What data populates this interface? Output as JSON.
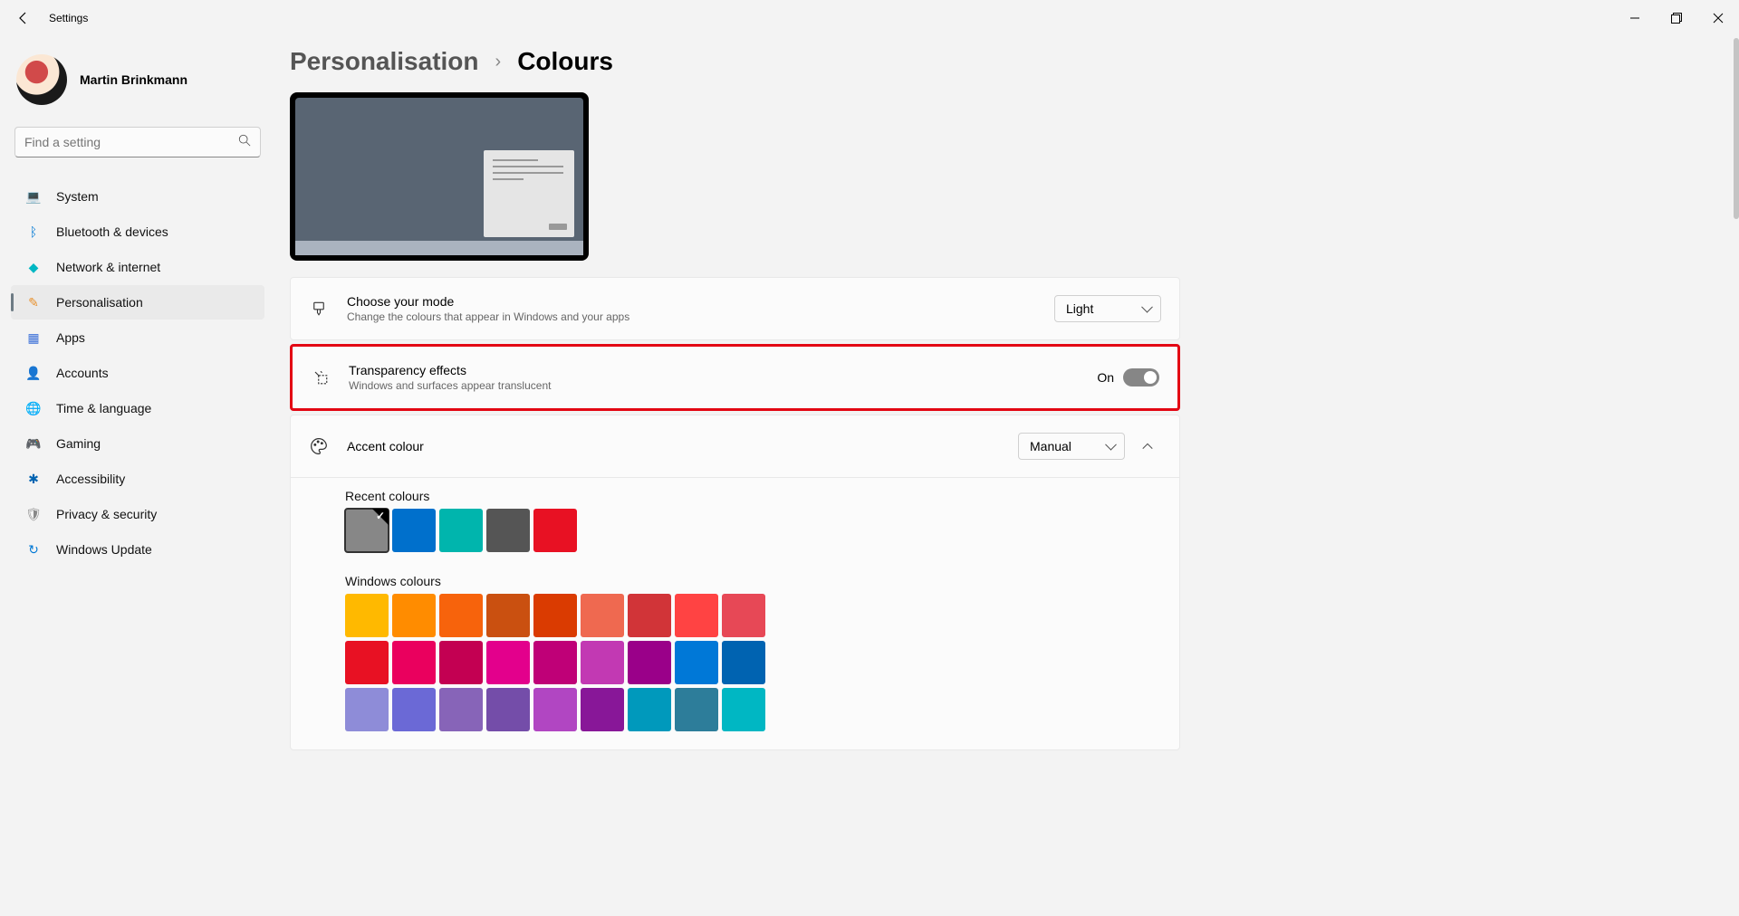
{
  "app": {
    "title": "Settings"
  },
  "user": {
    "name": "Martin Brinkmann"
  },
  "search": {
    "placeholder": "Find a setting"
  },
  "nav": {
    "items": [
      {
        "label": "System",
        "icon": "💻",
        "color": "#0078d4"
      },
      {
        "label": "Bluetooth & devices",
        "icon": "ᛒ",
        "color": "#0078d4"
      },
      {
        "label": "Network & internet",
        "icon": "◆",
        "color": "#00b7c3"
      },
      {
        "label": "Personalisation",
        "icon": "✎",
        "color": "#e8912d",
        "active": true
      },
      {
        "label": "Apps",
        "icon": "▦",
        "color": "#3a6fd8"
      },
      {
        "label": "Accounts",
        "icon": "👤",
        "color": "#107c10"
      },
      {
        "label": "Time & language",
        "icon": "🌐",
        "color": "#0078d4"
      },
      {
        "label": "Gaming",
        "icon": "🎮",
        "color": "#888"
      },
      {
        "label": "Accessibility",
        "icon": "✱",
        "color": "#0063b1"
      },
      {
        "label": "Privacy & security",
        "icon": "🛡",
        "color": "#888"
      },
      {
        "label": "Windows Update",
        "icon": "↻",
        "color": "#0078d4"
      }
    ]
  },
  "breadcrumb": {
    "parent": "Personalisation",
    "current": "Colours"
  },
  "mode": {
    "title": "Choose your mode",
    "sub": "Change the colours that appear in Windows and your apps",
    "value": "Light"
  },
  "transparency": {
    "title": "Transparency effects",
    "sub": "Windows and surfaces appear translucent",
    "state": "On"
  },
  "accent": {
    "title": "Accent colour",
    "value": "Manual",
    "recent_label": "Recent colours",
    "recent": [
      "#878787",
      "#0070cc",
      "#00b5ad",
      "#555555",
      "#e81123"
    ],
    "windows_label": "Windows colours",
    "windows": [
      "#ffb900",
      "#ff8c00",
      "#f7630c",
      "#ca5010",
      "#da3b01",
      "#ef6950",
      "#d13438",
      "#ff4343",
      "#e74856",
      "#e81123",
      "#ea005e",
      "#c30052",
      "#e3008c",
      "#bf0077",
      "#c239b3",
      "#9a0089",
      "#0078d7",
      "#0063b1",
      "#8e8cd8",
      "#6b69d6",
      "#8764b8",
      "#744da9",
      "#b146c2",
      "#881798",
      "#0099bc",
      "#2d7d9a",
      "#00b7c3"
    ]
  }
}
